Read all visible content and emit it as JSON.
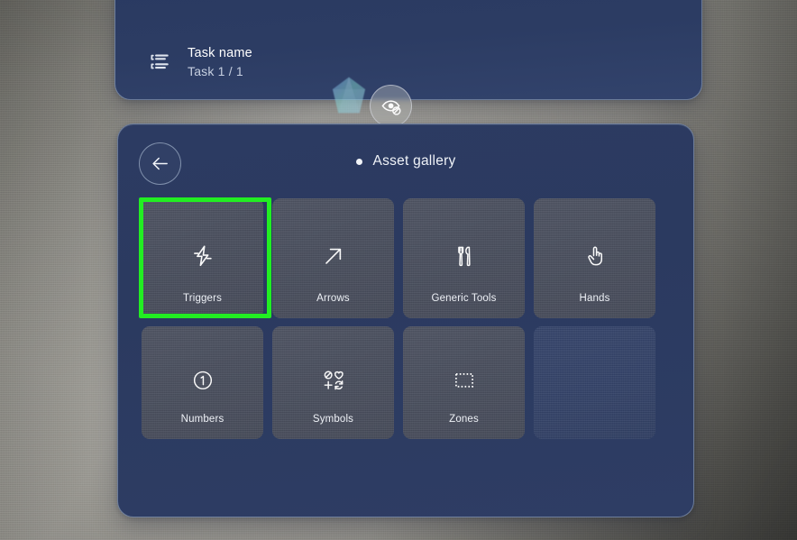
{
  "scene": {
    "background_color": "#c8c7c3",
    "panel_color": "#2b3a60",
    "tile_color": "#4a4f5e",
    "selection_color": "#22ee22"
  },
  "task_panel": {
    "icon": "task-list-icon",
    "task_name": "Task name",
    "task_count": "Task 1 / 1"
  },
  "handle": {
    "gem_icon": "gem-handle-icon",
    "hide_button_icon": "eye-off-icon"
  },
  "gallery": {
    "back_icon": "arrow-left-icon",
    "title_dot": "status-dot",
    "title": "Asset gallery",
    "tiles": [
      {
        "label": "Triggers",
        "icon": "lightning-bolt-icon",
        "selected": true,
        "empty": false
      },
      {
        "label": "Arrows",
        "icon": "arrow-up-right-icon",
        "selected": false,
        "empty": false
      },
      {
        "label": "Generic Tools",
        "icon": "tools-icon",
        "selected": false,
        "empty": false
      },
      {
        "label": "Hands",
        "icon": "pointing-hand-icon",
        "selected": false,
        "empty": false
      },
      {
        "label": "Numbers",
        "icon": "circled-one-icon",
        "selected": false,
        "empty": false
      },
      {
        "label": "Symbols",
        "icon": "symbols-grid-icon",
        "selected": false,
        "empty": false
      },
      {
        "label": "Zones",
        "icon": "dashed-square-icon",
        "selected": false,
        "empty": false
      },
      {
        "label": "",
        "icon": "",
        "selected": false,
        "empty": true
      }
    ]
  }
}
